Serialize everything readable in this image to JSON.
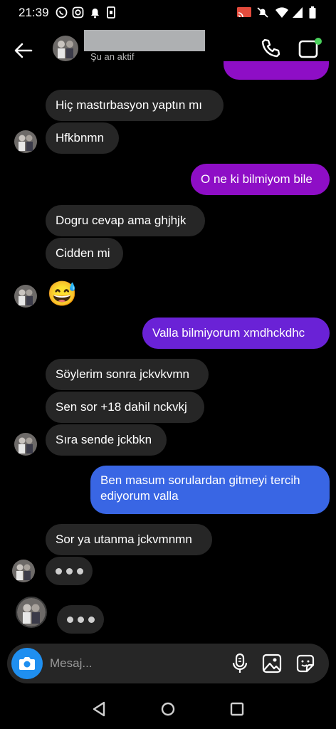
{
  "status_bar": {
    "time": "21:39"
  },
  "header": {
    "contact_status": "Şu an aktif",
    "back_icon": "arrow-left-icon",
    "call_icon": "phone-icon",
    "video_icon": "video-camera-icon"
  },
  "messages": [
    {
      "text": "Hiç mastırbasyon yaptın mı",
      "dir": "in"
    },
    {
      "text": "Hfkbnmn",
      "dir": "in"
    },
    {
      "text": "O ne ki bilmiyom bile",
      "dir": "out"
    },
    {
      "text": "Dogru cevap ama ghjhjk",
      "dir": "in"
    },
    {
      "text": "Cidden mi",
      "dir": "in"
    },
    {
      "text": "😅",
      "dir": "in"
    },
    {
      "text": "Valla bilmiyorum xmdhckdhc",
      "dir": "out"
    },
    {
      "text": "Söylerim sonra jckvkvmn",
      "dir": "in"
    },
    {
      "text": "Sen sor +18 dahil nckvkj",
      "dir": "in"
    },
    {
      "text": "Sıra sende jckbkn",
      "dir": "in"
    },
    {
      "text": "Ben masum sorulardan gitmeyi tercih ediyorum valla",
      "dir": "out"
    },
    {
      "text": "Sor ya utanma jckvmnmn",
      "dir": "in"
    }
  ],
  "composer": {
    "placeholder": "Mesaj..."
  },
  "colors": {
    "incoming_bubble": "#262626",
    "outgoing_violet": "#8e0ec6",
    "outgoing_purple": "#6a22d6",
    "outgoing_blue": "#3966e4",
    "camera_button": "#1f8ff0"
  },
  "nav": {
    "back": "triangle-back-icon",
    "home": "circle-home-icon",
    "recents": "square-recents-icon"
  }
}
